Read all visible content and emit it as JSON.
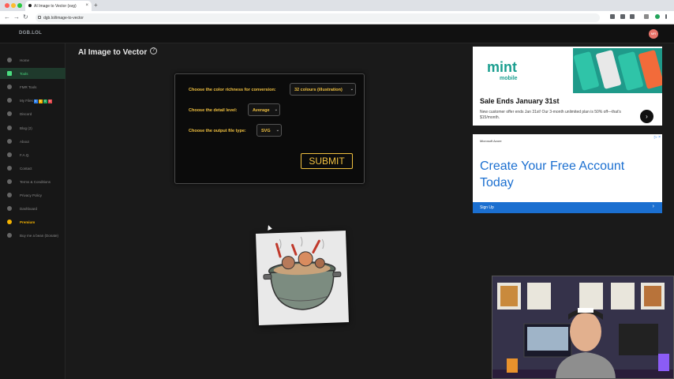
{
  "browser": {
    "tab_title": "AI Image to Vector (svg)",
    "tab_close": "×",
    "new_tab": "+",
    "url": "dgb.lol/image-to-vector",
    "nav": {
      "back": "←",
      "forward": "→",
      "reload": "↻"
    }
  },
  "site": {
    "logo": "DGB.LOL",
    "avatar_initials": "MR"
  },
  "sidebar": {
    "items": [
      {
        "label": "Home",
        "icon": "home-icon"
      },
      {
        "label": "Tools",
        "icon": "grid-icon",
        "active": true
      },
      {
        "label": "FMR Tools",
        "icon": "tools-icon"
      },
      {
        "label": "My Files",
        "icon": "folder-icon",
        "badges": [
          "0",
          "0",
          "0",
          "0"
        ]
      },
      {
        "label": "Discord",
        "icon": "discord-icon"
      },
      {
        "label": "Blog (2)",
        "icon": "blog-icon"
      },
      {
        "label": "About",
        "icon": "info-icon"
      },
      {
        "label": "F.A.Q.",
        "icon": "question-icon"
      },
      {
        "label": "Contact",
        "icon": "mail-icon"
      },
      {
        "label": "Terms & Conditions",
        "icon": "document-icon"
      },
      {
        "label": "Privacy Policy",
        "icon": "shield-icon"
      },
      {
        "label": "Dashboard",
        "icon": "dashboard-icon"
      },
      {
        "label": "Premium",
        "icon": "star-icon",
        "premium": true
      },
      {
        "label": "Buy me a bean (Donate)",
        "icon": "coffee-icon"
      }
    ],
    "badge_colors": [
      "#2b7de9",
      "#f5b301",
      "#22a35a",
      "#e5484d"
    ]
  },
  "main": {
    "title": "AI Image to Vector",
    "help_glyph": "?",
    "form": {
      "color_label": "Choose the color richness for conversion:",
      "color_value": "32 colours (illustration)",
      "detail_label": "Choose the detail level:",
      "detail_value": "Average",
      "filetype_label": "Choose the output file type:",
      "filetype_value": "SVG",
      "caret": "⌄",
      "submit_label": "SUBMIT"
    }
  },
  "ads": {
    "mint": {
      "logo": "mint",
      "sub": "mobile",
      "headline": "Sale Ends January 31st",
      "body": "New customer offer ends Jan 31st! Our 3-month unlimited plan is 50% off—that's $15/month.",
      "arrow": "›",
      "badge": "▷ ×"
    },
    "azure": {
      "brand": "Microsoft Azure",
      "headline": "Create Your Free Account Today",
      "cta": "Sign Up",
      "cta_chevron": "›",
      "badge": "▷ ×"
    }
  },
  "colors": {
    "accent_gold": "#f0c040",
    "active_green": "#4ade80",
    "azure_blue": "#1b6fd0",
    "mint_teal": "#1a9e8f"
  }
}
